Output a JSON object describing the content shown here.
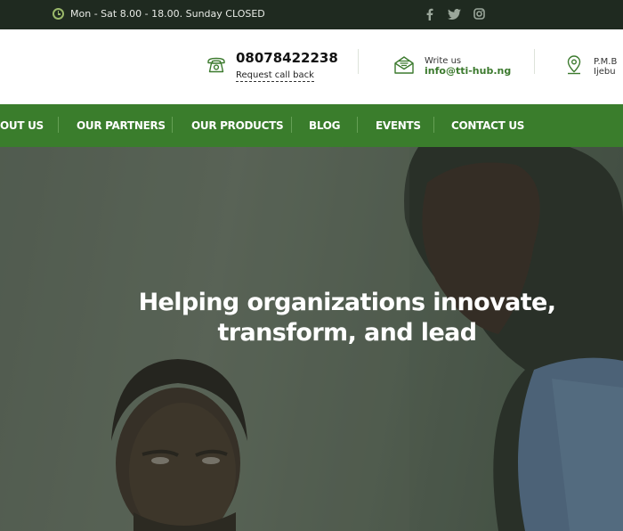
{
  "topbar": {
    "hours_text": "Mon - Sat 8.00 - 18.00. Sunday CLOSED",
    "social": [
      "facebook-icon",
      "twitter-icon",
      "instagram-icon"
    ]
  },
  "contact": {
    "phone": "08078422238",
    "callback_label": "Request call back",
    "write_label": "Write us",
    "email": "info@tti-hub.ng",
    "address_line1": "P.M.B",
    "address_line2": "Ijebu"
  },
  "nav": {
    "items": [
      "OUT US",
      "OUR PARTNERS",
      "OUR PRODUCTS",
      "BLOG",
      "EVENTS",
      "CONTACT US"
    ]
  },
  "hero": {
    "headline_line1": "Helping organizations innovate,",
    "headline_line2": "transform, and lead"
  },
  "colors": {
    "topbar_bg": "#1f2a20",
    "nav_bg": "#3a7d2c",
    "accent_green": "#3c7a2e"
  }
}
